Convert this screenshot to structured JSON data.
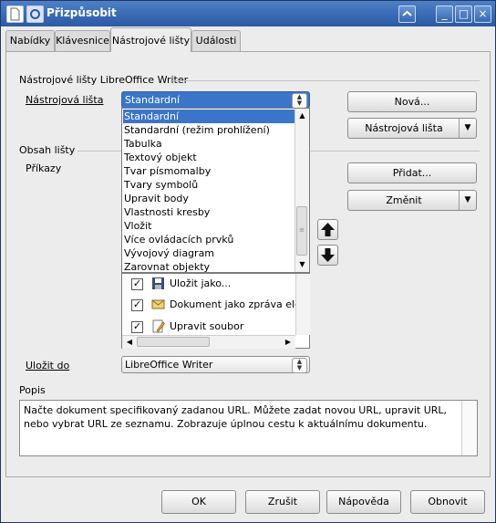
{
  "window": {
    "title": "Přizpůsobit",
    "minimize_glyph": "_",
    "maximize_glyph": "□",
    "close_glyph": "×"
  },
  "tabs": [
    {
      "label": "Nabídky",
      "active": false
    },
    {
      "label": "Klávesnice",
      "active": false
    },
    {
      "label": "Nástrojové lišty",
      "active": true
    },
    {
      "label": "Události",
      "active": false
    }
  ],
  "toolbars_section": {
    "heading": "Nástrojové lišty LibreOffice Writer",
    "toolbar_label": "Nástrojová lišta",
    "toolbar_value": "Standardní",
    "new_button": "Nová...",
    "toolbar_menu_button": "Nástrojová lišta"
  },
  "toolbar_options": [
    "Standardní",
    "Standardní (režim prohlížení)",
    "Tabulka",
    "Textový objekt",
    "Tvar písmomalby",
    "Tvary symbolů",
    "Upravit body",
    "Vlastnosti kresby",
    "Vložit",
    "Více ovládacích prvků",
    "Vývojový diagram",
    "Zarovnat objekty"
  ],
  "selected_option_index": 0,
  "contents_section": {
    "heading": "Obsah lišty",
    "commands_label": "Příkazy",
    "add_button": "Přidat...",
    "modify_button": "Změnit"
  },
  "commands": [
    {
      "label": "Uložit jako...",
      "checked": true,
      "icon": "save-as-icon"
    },
    {
      "label": "Dokument jako zpráva elektronické pošty",
      "checked": true,
      "icon": "email-document-icon"
    },
    {
      "label": "Upravit soubor",
      "checked": true,
      "icon": "edit-file-icon"
    }
  ],
  "save_in": {
    "label": "Uložit do",
    "value": "LibreOffice Writer"
  },
  "description": {
    "label": "Popis",
    "text": "Načte dokument specifikovaný zadanou URL. Můžete zadat novou URL, upravit URL, nebo vybrat URL ze seznamu. Zobrazuje úplnou cestu k aktuálnímu dokumentu."
  },
  "footer": {
    "ok": "OK",
    "cancel": "Zrušit",
    "help": "Nápověda",
    "reset": "Obnovit"
  },
  "colors": {
    "titlebar": "#2a5aa4",
    "selection": "#3b75c9",
    "dialog_bg": "#ececec"
  }
}
